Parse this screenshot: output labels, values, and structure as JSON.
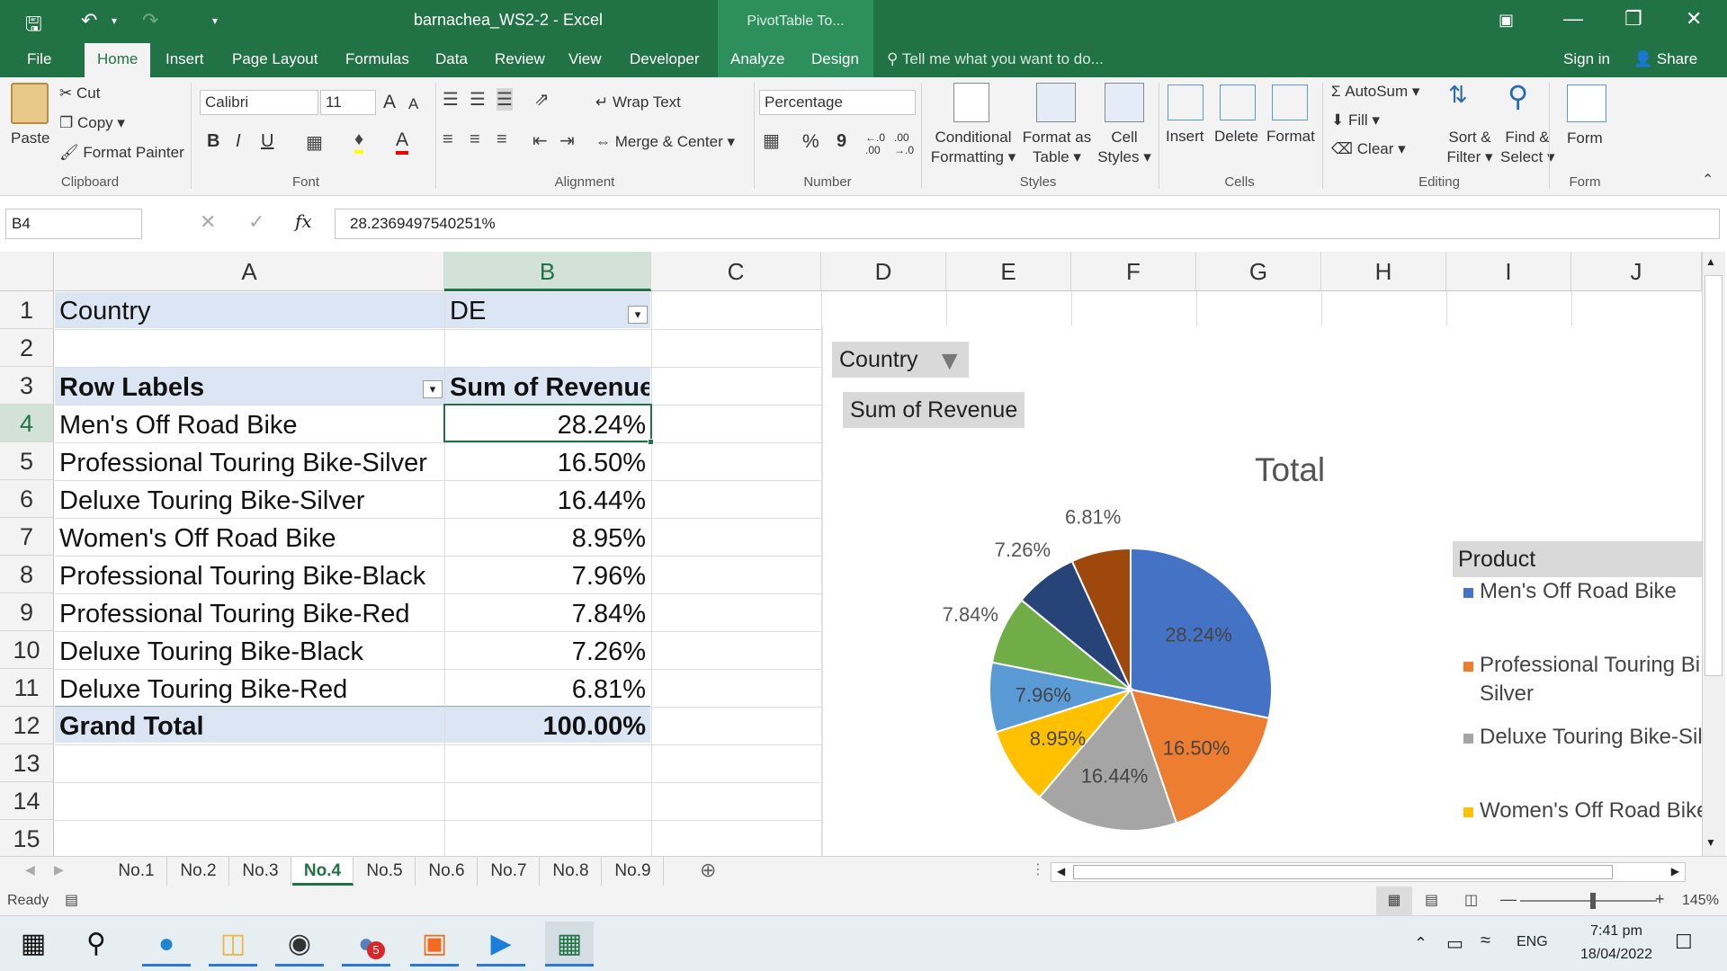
{
  "window": {
    "title": "barnachea_WS2-2  -  Excel",
    "context_tab_title": "PivotTable To..."
  },
  "menu": {
    "tabs": [
      "File",
      "Home",
      "Insert",
      "Page Layout",
      "Formulas",
      "Data",
      "Review",
      "View",
      "Developer",
      "Analyze",
      "Design"
    ],
    "active": "Home",
    "tell_me": "Tell me what you want to do...",
    "sign_in": "Sign in",
    "share": "Share"
  },
  "ribbon": {
    "clipboard": {
      "paste": "Paste",
      "cut": "Cut",
      "copy": "Copy",
      "format_painter": "Format Painter",
      "group": "Clipboard"
    },
    "font": {
      "name": "Calibri",
      "size": "11",
      "bold": "B",
      "italic": "I",
      "underline": "U",
      "grow": "A",
      "shrink": "A",
      "font_color": "A",
      "group": "Font"
    },
    "alignment": {
      "wrap_text": "Wrap Text",
      "merge_center": "Merge & Center",
      "group": "Alignment"
    },
    "number": {
      "format": "Percentage",
      "percent": "%",
      "comma": "9",
      "inc_decimal": "←.0\n.00",
      "dec_decimal": ".00\n→.0",
      "group": "Number"
    },
    "styles": {
      "conditional_1": "Conditional",
      "conditional_2": "Formatting",
      "format_table_1": "Format as",
      "format_table_2": "Table",
      "cell_styles_1": "Cell",
      "cell_styles_2": "Styles",
      "group": "Styles"
    },
    "cells": {
      "insert": "Insert",
      "delete": "Delete",
      "format": "Format",
      "group": "Cells"
    },
    "editing": {
      "autosum": "AutoSum",
      "fill": "Fill",
      "clear": "Clear",
      "sort_1": "Sort &",
      "sort_2": "Filter",
      "find_1": "Find &",
      "find_2": "Select",
      "group": "Editing"
    },
    "form": {
      "label": "Form",
      "group": "Form"
    }
  },
  "formula_bar": {
    "name_box": "B4",
    "fx": "fx",
    "value": "28.2369497540251%"
  },
  "columns": [
    "A",
    "B",
    "C",
    "D",
    "E",
    "F",
    "G",
    "H",
    "I",
    "J"
  ],
  "rows": [
    "1",
    "2",
    "3",
    "4",
    "5",
    "6",
    "7",
    "8",
    "9",
    "10",
    "11",
    "12",
    "13",
    "14",
    "15"
  ],
  "pivot": {
    "filter_label": "Country",
    "filter_value": "DE",
    "row_labels": "Row Labels",
    "sum_header": "Sum of Revenue",
    "items": [
      {
        "label": "Men's Off Road Bike",
        "value": "28.24%"
      },
      {
        "label": "Professional Touring Bike-Silver",
        "value": "16.50%"
      },
      {
        "label": "Deluxe Touring Bike-Silver",
        "value": "16.44%"
      },
      {
        "label": "Women's Off Road Bike",
        "value": "8.95%"
      },
      {
        "label": "Professional Touring Bike-Black",
        "value": "7.96%"
      },
      {
        "label": "Professional Touring Bike-Red",
        "value": "7.84%"
      },
      {
        "label": "Deluxe Touring Bike-Black",
        "value": "7.26%"
      },
      {
        "label": "Deluxe Touring Bike-Red",
        "value": "6.81%"
      }
    ],
    "grand_total_label": "Grand Total",
    "grand_total_value": "100.00%"
  },
  "chart_data": {
    "type": "pie",
    "title": "Total",
    "filter_button": "Country",
    "value_button": "Sum of Revenue",
    "legend_title": "Product",
    "legend_visible": [
      "Men's Off Road Bike",
      "Professional Touring Bi",
      "Silver",
      "Deluxe Touring Bike-Sil",
      "Women's Off Road Bike"
    ],
    "categories": [
      "Men's Off Road Bike",
      "Professional Touring Bike-Silver",
      "Deluxe Touring Bike-Silver",
      "Women's Off Road Bike",
      "Professional Touring Bike-Black",
      "Professional Touring Bike-Red",
      "Deluxe Touring Bike-Black",
      "Deluxe Touring Bike-Red"
    ],
    "values": [
      28.24,
      16.5,
      16.44,
      8.95,
      7.96,
      7.84,
      7.26,
      6.81
    ],
    "labels": [
      "28.24%",
      "16.50%",
      "16.44%",
      "8.95%",
      "7.96%",
      "7.84%",
      "7.26%",
      "6.81%"
    ],
    "colors": [
      "#4472c4",
      "#ed7d31",
      "#a5a5a5",
      "#ffc000",
      "#5b9bd5",
      "#70ad47",
      "#264478",
      "#9e480e"
    ]
  },
  "sheet_tabs": {
    "tabs": [
      "No.1",
      "No.2",
      "No.3",
      "No.4",
      "No.5",
      "No.6",
      "No.7",
      "No.8",
      "No.9"
    ],
    "active": "No.4"
  },
  "status": {
    "mode": "Ready",
    "zoom": "145%"
  },
  "taskbar": {
    "lang": "ENG",
    "time": "7:41 pm",
    "date": "18/04/2022",
    "badge": "5"
  },
  "colors": {
    "excel_green": "#217346",
    "pivot_header": "#dbe5f3"
  }
}
